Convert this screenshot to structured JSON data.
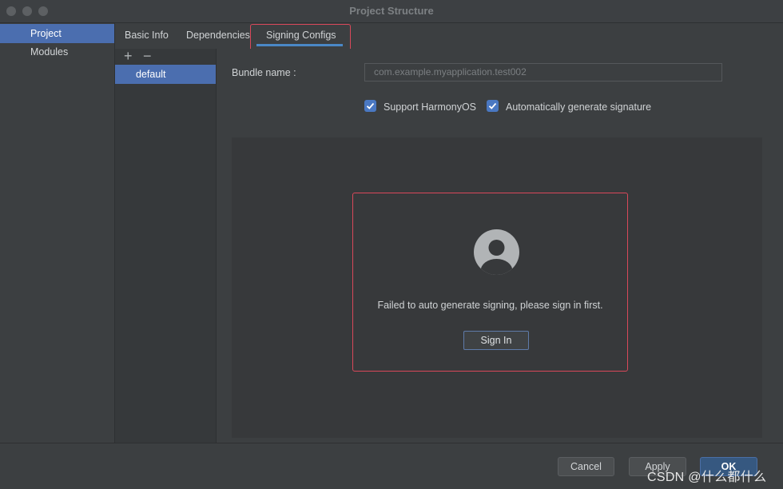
{
  "window": {
    "title": "Project Structure"
  },
  "sidebar": {
    "items": [
      {
        "label": "Project"
      },
      {
        "label": "Modules"
      }
    ]
  },
  "tabs": [
    {
      "label": "Basic Info"
    },
    {
      "label": "Dependencies"
    },
    {
      "label": "Signing Configs"
    }
  ],
  "configs": {
    "add_symbol": "+",
    "remove_symbol": "−",
    "items": [
      {
        "label": "default"
      }
    ]
  },
  "form": {
    "bundle_label": "Bundle name :",
    "bundle_value": "com.example.myapplication.test002",
    "support_harmonyos": {
      "label": "Support HarmonyOS",
      "checked": true
    },
    "auto_signature": {
      "label": "Automatically generate signature",
      "checked": true
    }
  },
  "signing": {
    "message": "Failed to auto generate signing, please sign in first.",
    "sign_in_label": "Sign In"
  },
  "footer": {
    "cancel_label": "Cancel",
    "apply_label": "Apply",
    "ok_label": "OK"
  },
  "watermark": "CSDN @什么都什么",
  "colors": {
    "accent": "#4b6eaf",
    "highlight_border": "#d9485a",
    "checkbox": "#4a78c2"
  }
}
